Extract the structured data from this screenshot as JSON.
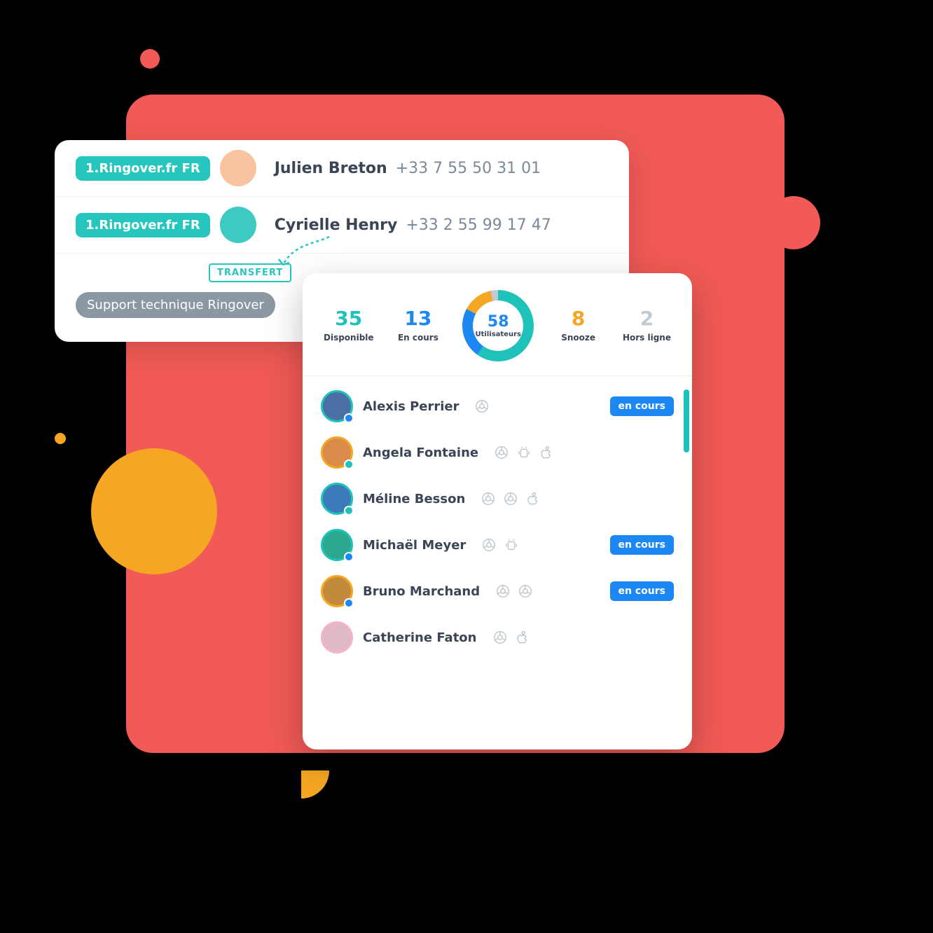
{
  "calls": {
    "rows": [
      {
        "source": "1.Ringover.fr FR",
        "name": "Julien Breton",
        "number": "+33 7 55 50 31 01"
      },
      {
        "source": "1.Ringover.fr FR",
        "name": "Cyrielle Henry",
        "number": "+33 2 55 99 17 47"
      }
    ],
    "transfer_label": "TRANSFERT",
    "transfer_target": "Support technique Ringover"
  },
  "stats": {
    "disponible": {
      "value": "35",
      "label": "Disponible"
    },
    "encours": {
      "value": "13",
      "label": "En cours"
    },
    "snooze": {
      "value": "8",
      "label": "Snooze"
    },
    "offline": {
      "value": "2",
      "label": "Hors ligne"
    },
    "total": {
      "value": "58",
      "label": "Utilisateurs"
    }
  },
  "status_label": "en cours",
  "users": [
    {
      "name": "Alexis Perrier",
      "status": "blue",
      "ring": "teal",
      "devices": [
        "chrome"
      ],
      "badge": true
    },
    {
      "name": "Angela Fontaine",
      "status": "teal",
      "ring": "orange",
      "devices": [
        "chrome",
        "android",
        "apple"
      ],
      "badge": false
    },
    {
      "name": "Méline Besson",
      "status": "teal",
      "ring": "teal",
      "devices": [
        "chrome",
        "chrome",
        "apple"
      ],
      "badge": false
    },
    {
      "name": "Michaël Meyer",
      "status": "blue",
      "ring": "teal",
      "devices": [
        "chrome",
        "android"
      ],
      "badge": true
    },
    {
      "name": "Bruno Marchand",
      "status": "blue",
      "ring": "orange",
      "devices": [
        "chrome",
        "chrome"
      ],
      "badge": true
    },
    {
      "name": "Catherine Faton",
      "status": "",
      "ring": "pink",
      "devices": [
        "chrome",
        "apple"
      ],
      "badge": false
    }
  ]
}
